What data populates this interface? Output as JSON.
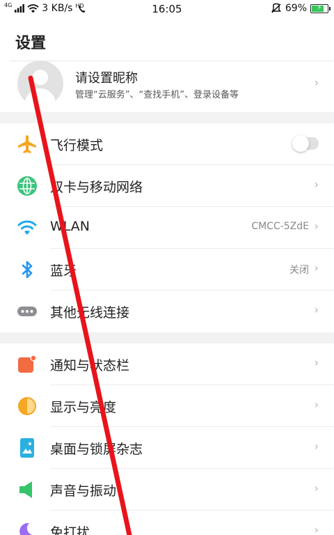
{
  "status_bar": {
    "network_tag": "4G",
    "speed": "3 KB/s",
    "hd_tag": "HD",
    "time": "16:05",
    "battery": "69%",
    "battery_level": 0.69,
    "battery_color": "#34c759"
  },
  "header": {
    "title": "设置"
  },
  "account": {
    "name": "请设置昵称",
    "subtitle": "管理“云服务”、“查找手机”、登录设备等"
  },
  "chevron_glyph": "›",
  "connectivity": {
    "items": [
      {
        "label": "飞行模式",
        "icon": "airplane-icon",
        "type": "toggle",
        "toggle_on": false
      },
      {
        "label": "双卡与移动网络",
        "icon": "globe-icon",
        "type": "nav"
      },
      {
        "label": "WLAN",
        "icon": "wifi-icon",
        "type": "nav",
        "value": "CMCC-5ZdE"
      },
      {
        "label": "蓝牙",
        "icon": "bluetooth-icon",
        "type": "nav",
        "value": "关闭"
      },
      {
        "label": "其他无线连接",
        "icon": "more-dots-icon",
        "type": "nav"
      }
    ]
  },
  "personalization": {
    "items": [
      {
        "label": "通知与状态栏",
        "icon": "notification-icon",
        "type": "nav"
      },
      {
        "label": "显示与亮度",
        "icon": "brightness-icon",
        "type": "nav"
      },
      {
        "label": "桌面与锁屏杂志",
        "icon": "wallpaper-icon",
        "type": "nav"
      },
      {
        "label": "声音与振动",
        "icon": "speaker-icon",
        "type": "nav"
      },
      {
        "label": "免打扰",
        "icon": "moon-icon",
        "type": "nav"
      }
    ]
  },
  "colors": {
    "airplane": "#f5a623",
    "globe": "#3cc47c",
    "wifi": "#22a9e8",
    "bluetooth": "#2196f3",
    "more": "#8e8e93",
    "notification": "#f26b43",
    "brightness": "#f5a623",
    "wallpaper": "#2ab0e0",
    "speaker": "#36c46b",
    "moon": "#9b6cf3",
    "annotation_line": "#e8141b"
  }
}
